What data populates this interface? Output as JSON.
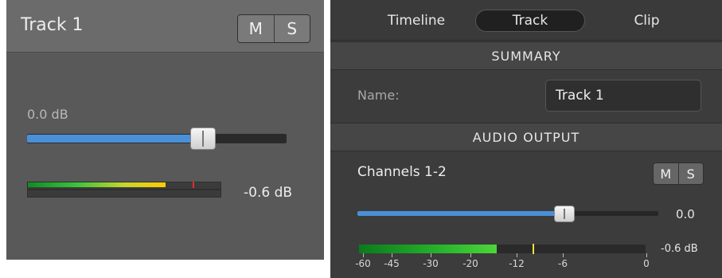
{
  "left": {
    "title": "Track 1",
    "mute_label": "M",
    "solo_label": "S",
    "gain_text": "0.0 dB",
    "fader_level": 0.71,
    "meter_level": 0.72,
    "level_text": "-0.6 dB",
    "meter_colors": [
      "#0f8c24",
      "#3ac43a",
      "#c4d62c",
      "#ffcc00"
    ],
    "peak_color": "#e02e2e"
  },
  "right": {
    "tabs": [
      {
        "label": "Timeline",
        "active": false
      },
      {
        "label": "Track",
        "active": true
      },
      {
        "label": "Clip",
        "active": false
      }
    ],
    "summary_header": "SUMMARY",
    "name_label": "Name:",
    "name_value": "Track 1",
    "audio_header": "AUDIO OUTPUT",
    "channels_label": "Channels 1-2",
    "mute_label": "M",
    "solo_label": "S",
    "fader_level": 0.7,
    "gain_text": "0.0",
    "meter_level": 0.48,
    "level_text": "-0.6 dB",
    "meter_scale": [
      "-60",
      "-45",
      "-30",
      "-20",
      "-12",
      "-6",
      "0"
    ],
    "accent_color": "#4a90d9",
    "peak_color": "#f2e23a"
  }
}
